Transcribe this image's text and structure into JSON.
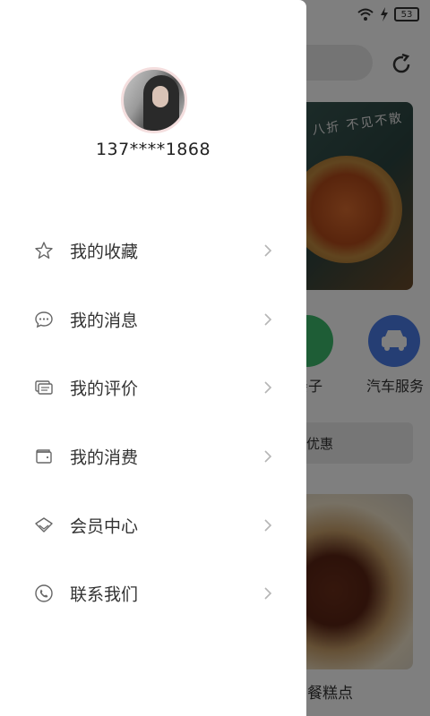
{
  "status_bar": {
    "battery": "53"
  },
  "user": {
    "phone": "137****1868"
  },
  "menu": {
    "items": [
      {
        "label": "我的收藏",
        "icon": "star-icon"
      },
      {
        "label": "我的消息",
        "icon": "chat-bubble-icon"
      },
      {
        "label": "我的评价",
        "icon": "review-icon"
      },
      {
        "label": "我的消费",
        "icon": "wallet-icon"
      },
      {
        "label": "会员中心",
        "icon": "diamond-icon"
      },
      {
        "label": "联系我们",
        "icon": "phone-icon"
      }
    ]
  },
  "background": {
    "banner_text": "八折 不见不散",
    "categories": [
      {
        "label": "亲子",
        "color": "#3dbb6c",
        "icon": "bottle-icon"
      },
      {
        "label": "汽车服务",
        "color": "#4b7de8",
        "icon": "car-icon"
      }
    ],
    "promo_text": "优惠",
    "card_title": "餐糕点"
  },
  "colors": {
    "overlay": "rgba(0,0,0,0.5)",
    "drawer_bg": "#ffffff",
    "text": "#333333"
  }
}
